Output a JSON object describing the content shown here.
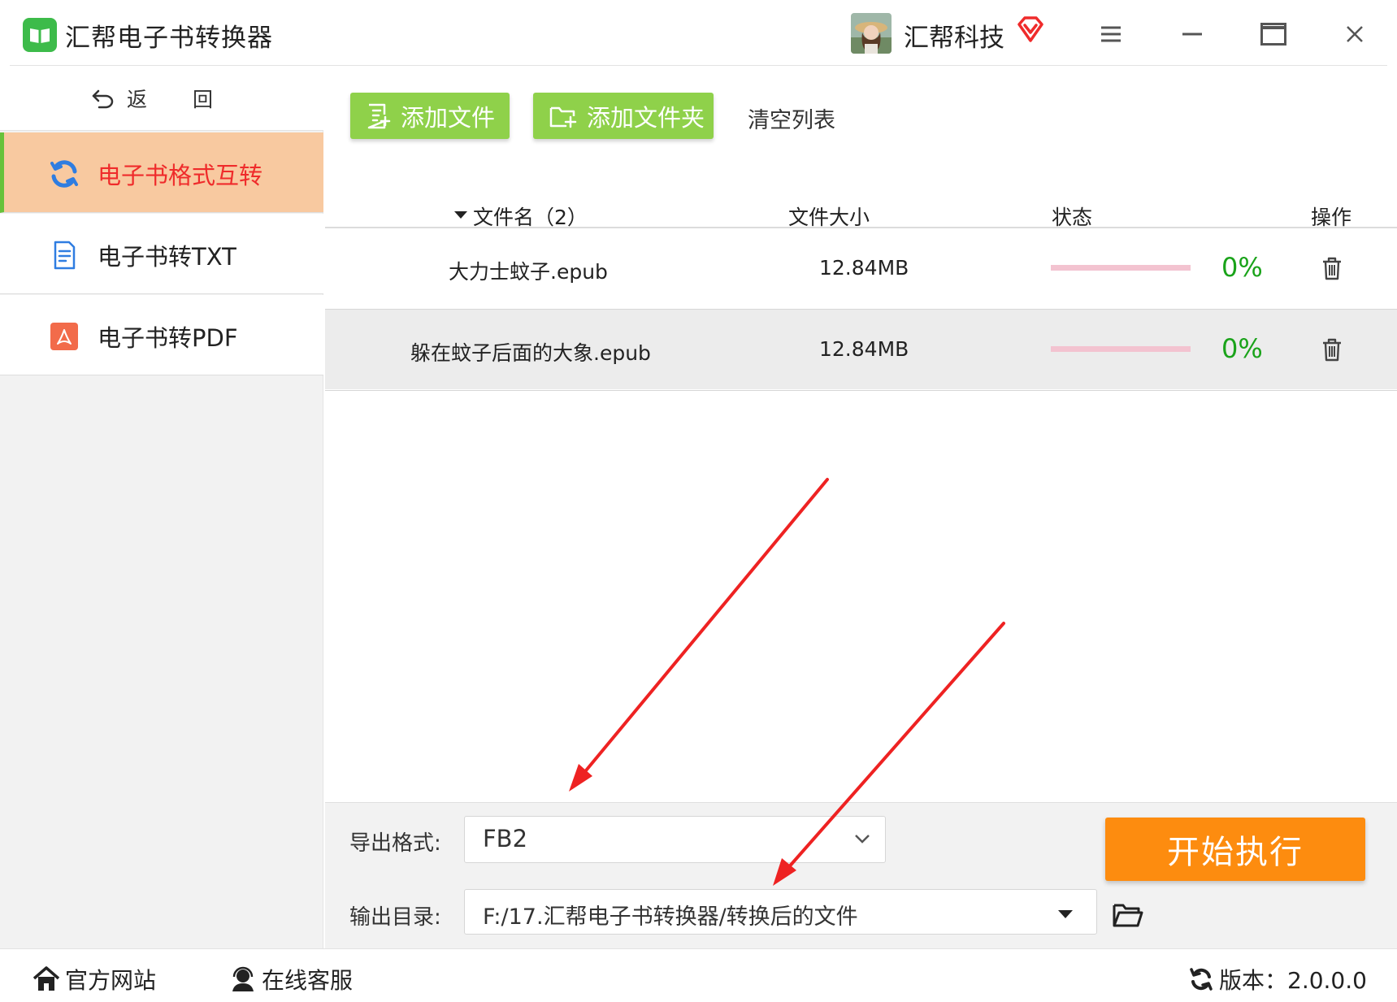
{
  "app": {
    "title": "汇帮电子书转换器",
    "company": "汇帮科技"
  },
  "sidebar": {
    "back_label": "返 回",
    "items": [
      {
        "label": "电子书格式互转",
        "icon": "sync-icon",
        "active": true
      },
      {
        "label": "电子书转TXT",
        "icon": "txt-file-icon",
        "active": false
      },
      {
        "label": "电子书转PDF",
        "icon": "pdf-icon",
        "active": false
      }
    ]
  },
  "toolbar": {
    "add_file": "添加文件",
    "add_folder": "添加文件夹",
    "clear_list": "清空列表"
  },
  "table": {
    "headers": {
      "filename": "文件名（2）",
      "size": "文件大小",
      "status": "状态",
      "action": "操作"
    },
    "rows": [
      {
        "name": "大力士蚊子.epub",
        "size": "12.84MB",
        "progress_pct": "0%"
      },
      {
        "name": "躲在蚊子后面的大象.epub",
        "size": "12.84MB",
        "progress_pct": "0%"
      }
    ]
  },
  "settings": {
    "format_label": "导出格式:",
    "format_value": "FB2",
    "dir_label": "输出目录:",
    "dir_value": "F:/17.汇帮电子书转换器/转换后的文件",
    "start_label": "开始执行"
  },
  "footer": {
    "website": "官方网站",
    "support": "在线客服",
    "version": "版本：2.0.0.0"
  },
  "colors": {
    "accent_green": "#8fd14a",
    "active_bg": "#f8c9a0",
    "active_text": "#ef2b2b",
    "start_orange": "#fd8c0f",
    "progress_green": "#1aa31a",
    "progress_track": "#f3c3d0",
    "arrow_red": "#ee2222"
  }
}
